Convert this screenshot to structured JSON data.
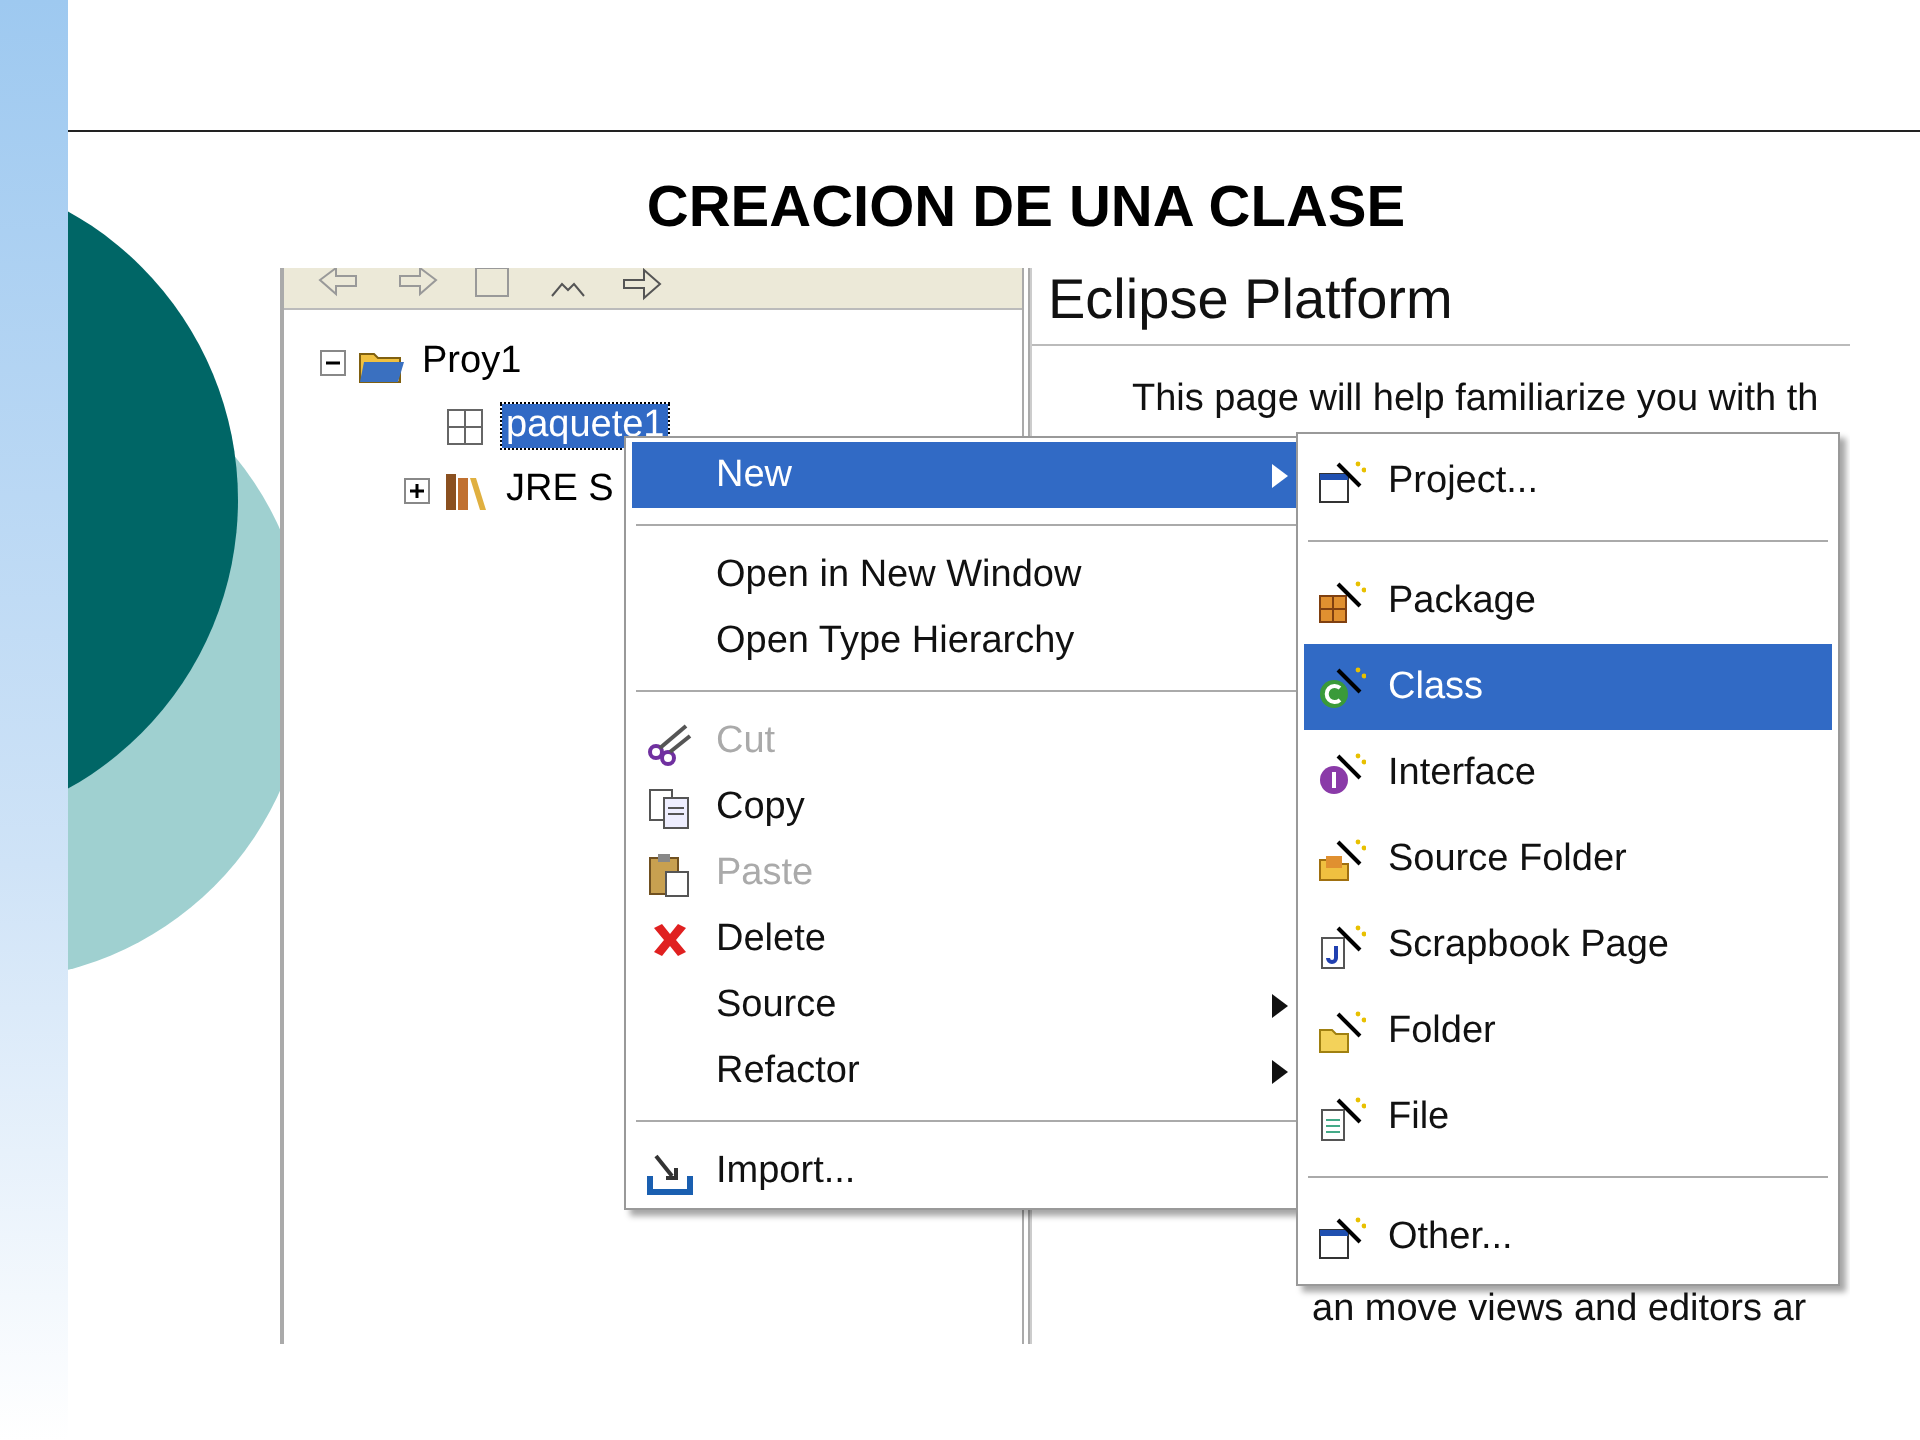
{
  "slide": {
    "title": "CREACION DE UNA CLASE"
  },
  "screenshot": {
    "tree": [
      {
        "label": "Proy1",
        "expanded": true,
        "selected": false,
        "children": [
          {
            "label": "paquete1",
            "selected": true
          },
          {
            "label": "JRE S",
            "expanded": false,
            "selected": false
          }
        ]
      }
    ],
    "editor": {
      "heading": "Eclipse Platform",
      "intro": "This page will help familiarize you with th",
      "footer": "an move views and editors ar"
    },
    "context_menu": [
      {
        "kind": "item",
        "label": "New",
        "submenu": true,
        "selected": true,
        "disabled": false
      },
      {
        "kind": "separator"
      },
      {
        "kind": "item",
        "label": "Open in New Window",
        "submenu": false,
        "selected": false,
        "disabled": false
      },
      {
        "kind": "item",
        "label": "Open Type Hierarchy",
        "submenu": false,
        "selected": false,
        "disabled": false
      },
      {
        "kind": "separator"
      },
      {
        "kind": "item",
        "label": "Cut",
        "submenu": false,
        "selected": false,
        "disabled": true
      },
      {
        "kind": "item",
        "label": "Copy",
        "submenu": false,
        "selected": false,
        "disabled": false
      },
      {
        "kind": "item",
        "label": "Paste",
        "submenu": false,
        "selected": false,
        "disabled": true
      },
      {
        "kind": "item",
        "label": "Delete",
        "submenu": false,
        "selected": false,
        "disabled": false
      },
      {
        "kind": "item",
        "label": "Source",
        "submenu": true,
        "selected": false,
        "disabled": false
      },
      {
        "kind": "item",
        "label": "Refactor",
        "submenu": true,
        "selected": false,
        "disabled": false
      },
      {
        "kind": "separator"
      },
      {
        "kind": "item",
        "label": "Import...",
        "submenu": false,
        "selected": false,
        "disabled": false
      }
    ],
    "new_submenu": [
      {
        "kind": "item",
        "label": "Project...",
        "selected": false
      },
      {
        "kind": "separator"
      },
      {
        "kind": "item",
        "label": "Package",
        "selected": false
      },
      {
        "kind": "item",
        "label": "Class",
        "selected": true
      },
      {
        "kind": "item",
        "label": "Interface",
        "selected": false
      },
      {
        "kind": "item",
        "label": "Source Folder",
        "selected": false
      },
      {
        "kind": "item",
        "label": "Scrapbook Page",
        "selected": false
      },
      {
        "kind": "item",
        "label": "Folder",
        "selected": false
      },
      {
        "kind": "item",
        "label": "File",
        "selected": false
      },
      {
        "kind": "separator"
      },
      {
        "kind": "item",
        "label": "Other...",
        "selected": false
      }
    ]
  }
}
